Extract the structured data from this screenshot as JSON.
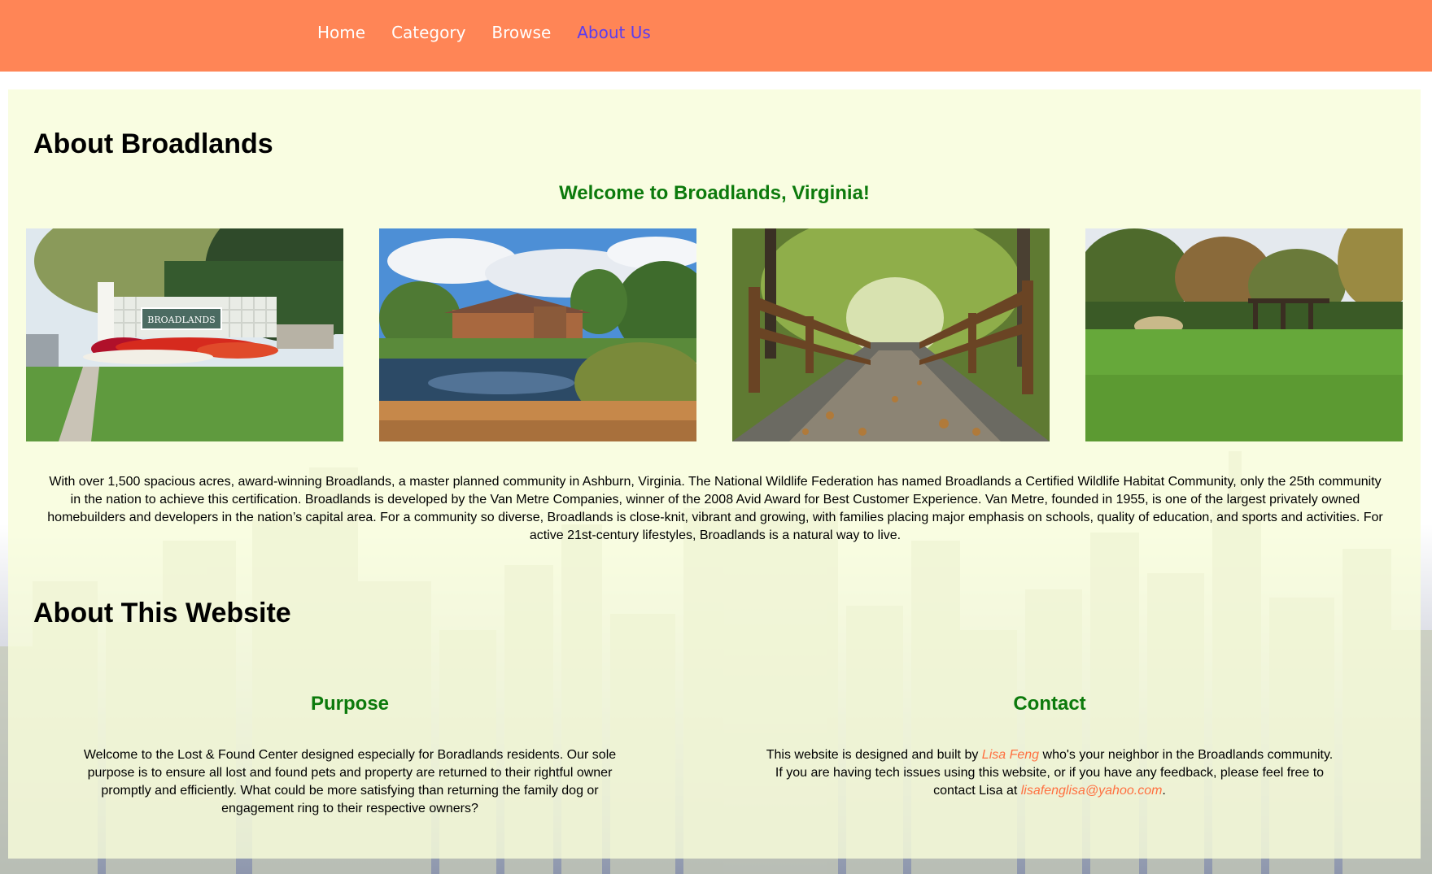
{
  "nav": {
    "items": [
      {
        "label": "Home",
        "active": false
      },
      {
        "label": "Category",
        "active": false
      },
      {
        "label": "Browse",
        "active": false
      },
      {
        "label": "About Us",
        "active": true
      }
    ]
  },
  "colors": {
    "header": "#ff8556",
    "active_nav": "#5a3cf0",
    "panel_bg": "#f8fcda",
    "heading_green": "#0c7a0c",
    "link": "#ff7040"
  },
  "about": {
    "title": "About Broadlands",
    "welcome": "Welcome to Broadlands, Virginia!",
    "photos": [
      {
        "icon": "broadlands-entrance-sign-photo",
        "sign_text": "BROADLANDS"
      },
      {
        "icon": "clubhouse-pond-photo"
      },
      {
        "icon": "wooden-footbridge-photo"
      },
      {
        "icon": "park-lawn-pergola-photo"
      }
    ],
    "description": "With over 1,500 spacious acres, award-winning Broadlands, a master planned community in Ashburn, Virginia. The National Wildlife Federation has named Broadlands a Certified Wildlife Habitat Community, only the 25th community in the nation to achieve this certification. Broadlands is developed by the Van Metre Companies, winner of the 2008 Avid Award for Best Customer Experience. Van Metre, founded in 1955, is one of the largest privately owned homebuilders and developers in the nation’s capital area. For a community so diverse, Broadlands is close-knit, vibrant and growing, with families placing major emphasis on schools, quality of education, and sports and activities. For active 21st-century lifestyles, Broadlands is a natural way to live."
  },
  "website": {
    "title": "About This Website",
    "purpose": {
      "heading": "Purpose",
      "text": "Welcome to the Lost & Found Center designed especially for Boradlands residents. Our sole purpose is to ensure all lost and found pets and property are returned to their rightful owner promptly and efficiently. What could be more satisfying than returning the family dog or engagement ring to their respective owners?"
    },
    "contact": {
      "heading": "Contact",
      "text_before": "This website is designed and built by ",
      "author": "Lisa Feng",
      "text_middle": " who's your neighbor in the Broadlands community. If you are having tech issues using this website, or if you have any feedback, please feel free to contact Lisa at ",
      "email": "lisafenglisa@yahoo.com",
      "text_after": "."
    }
  }
}
